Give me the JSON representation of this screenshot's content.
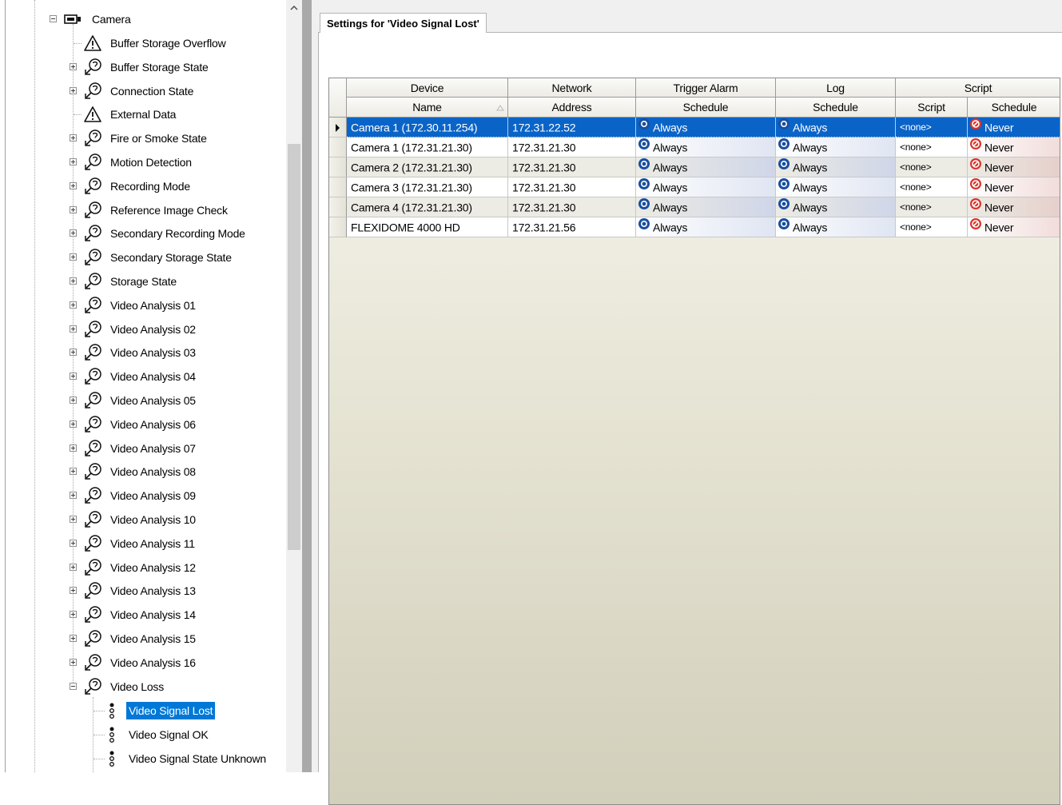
{
  "tree": {
    "root": {
      "label": "Camera"
    },
    "items": [
      {
        "label": "Buffer Storage Overflow",
        "icon": "warning-triangle-icon",
        "expandable": false
      },
      {
        "label": "Buffer Storage State",
        "icon": "state-link-icon",
        "expandable": true
      },
      {
        "label": "Connection State",
        "icon": "state-link-icon",
        "expandable": true
      },
      {
        "label": "External Data",
        "icon": "warning-triangle-icon",
        "expandable": false
      },
      {
        "label": "Fire or Smoke State",
        "icon": "state-link-icon",
        "expandable": true
      },
      {
        "label": "Motion Detection",
        "icon": "state-link-icon",
        "expandable": true
      },
      {
        "label": "Recording Mode",
        "icon": "state-link-icon",
        "expandable": true
      },
      {
        "label": "Reference Image Check",
        "icon": "state-link-icon",
        "expandable": true
      },
      {
        "label": "Secondary Recording Mode",
        "icon": "state-link-icon",
        "expandable": true
      },
      {
        "label": "Secondary Storage State",
        "icon": "state-link-icon",
        "expandable": true
      },
      {
        "label": "Storage State",
        "icon": "state-link-icon",
        "expandable": true
      },
      {
        "label": "Video Analysis 01",
        "icon": "state-link-icon",
        "expandable": true
      },
      {
        "label": "Video Analysis 02",
        "icon": "state-link-icon",
        "expandable": true
      },
      {
        "label": "Video Analysis 03",
        "icon": "state-link-icon",
        "expandable": true
      },
      {
        "label": "Video Analysis 04",
        "icon": "state-link-icon",
        "expandable": true
      },
      {
        "label": "Video Analysis 05",
        "icon": "state-link-icon",
        "expandable": true
      },
      {
        "label": "Video Analysis 06",
        "icon": "state-link-icon",
        "expandable": true
      },
      {
        "label": "Video Analysis 07",
        "icon": "state-link-icon",
        "expandable": true
      },
      {
        "label": "Video Analysis 08",
        "icon": "state-link-icon",
        "expandable": true
      },
      {
        "label": "Video Analysis 09",
        "icon": "state-link-icon",
        "expandable": true
      },
      {
        "label": "Video Analysis 10",
        "icon": "state-link-icon",
        "expandable": true
      },
      {
        "label": "Video Analysis 11",
        "icon": "state-link-icon",
        "expandable": true
      },
      {
        "label": "Video Analysis 12",
        "icon": "state-link-icon",
        "expandable": true
      },
      {
        "label": "Video Analysis 13",
        "icon": "state-link-icon",
        "expandable": true
      },
      {
        "label": "Video Analysis 14",
        "icon": "state-link-icon",
        "expandable": true
      },
      {
        "label": "Video Analysis 15",
        "icon": "state-link-icon",
        "expandable": true
      },
      {
        "label": "Video Analysis 16",
        "icon": "state-link-icon",
        "expandable": true
      },
      {
        "label": "Video Loss",
        "icon": "state-link-icon",
        "expandable": true,
        "expanded": true
      }
    ],
    "children": [
      {
        "label": "Video Signal Lost",
        "icon": "event-dots-icon",
        "selected": true
      },
      {
        "label": "Video Signal OK",
        "icon": "event-dots-icon",
        "selected": false
      },
      {
        "label": "Video Signal State Unknown",
        "icon": "event-dots-icon",
        "selected": false
      }
    ]
  },
  "tab": {
    "title": "Settings for 'Video Signal Lost'"
  },
  "grid": {
    "group_headers": [
      "Device",
      "Network",
      "Trigger Alarm",
      "Log",
      "Script"
    ],
    "column_headers": [
      "Name",
      "Address",
      "Schedule",
      "Schedule",
      "Script",
      "Schedule"
    ],
    "rows": [
      {
        "name": "Camera 1 (172.30.11.254)",
        "address": "172.31.22.52",
        "alarm": "Always",
        "log": "Always",
        "script": "<none>",
        "script_schedule": "Never",
        "selected": true
      },
      {
        "name": "Camera 1 (172.31.21.30)",
        "address": "172.31.21.30",
        "alarm": "Always",
        "log": "Always",
        "script": "<none>",
        "script_schedule": "Never"
      },
      {
        "name": "Camera 2 (172.31.21.30)",
        "address": "172.31.21.30",
        "alarm": "Always",
        "log": "Always",
        "script": "<none>",
        "script_schedule": "Never"
      },
      {
        "name": "Camera 3 (172.31.21.30)",
        "address": "172.31.21.30",
        "alarm": "Always",
        "log": "Always",
        "script": "<none>",
        "script_schedule": "Never"
      },
      {
        "name": "Camera 4 (172.31.21.30)",
        "address": "172.31.21.30",
        "alarm": "Always",
        "log": "Always",
        "script": "<none>",
        "script_schedule": "Never"
      },
      {
        "name": "FLEXIDOME 4000 HD",
        "address": "172.31.21.56",
        "alarm": "Always",
        "log": "Always",
        "script": "<none>",
        "script_schedule": "Never"
      }
    ]
  },
  "colors": {
    "selection": "#0078d7",
    "grid_selection": "#0a64c8",
    "always_icon": "#1a4fa0",
    "never_icon": "#d9342b"
  }
}
